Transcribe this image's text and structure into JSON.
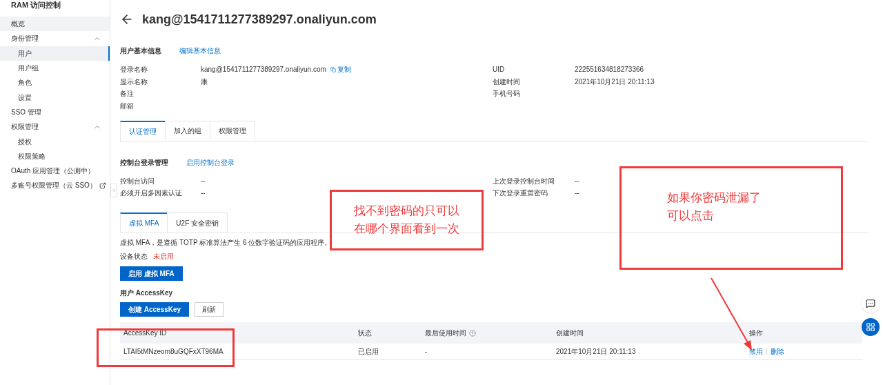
{
  "sidebar": {
    "title": "RAM 访问控制",
    "items": [
      {
        "label": "概览",
        "selected": false,
        "highlighted": true
      },
      {
        "label": "身份管理",
        "expanded": true,
        "children": [
          {
            "label": "用户",
            "selected": true
          },
          {
            "label": "用户组",
            "selected": false
          },
          {
            "label": "角色",
            "selected": false
          },
          {
            "label": "设置",
            "selected": false
          }
        ]
      },
      {
        "label": "SSO 管理",
        "selected": false
      },
      {
        "label": "权限管理",
        "expanded": true,
        "children": [
          {
            "label": "授权",
            "selected": false
          },
          {
            "label": "权限策略",
            "selected": false
          }
        ]
      },
      {
        "label": "OAuth 应用管理（公测中）",
        "selected": false
      },
      {
        "label": "多账号权限管理（云 SSO）",
        "selected": false,
        "external": true
      }
    ]
  },
  "page": {
    "title": "kang@1541711277389297.onaliyun.com"
  },
  "basic_info": {
    "heading": "用户基本信息",
    "action": "编辑基本信息",
    "left_fields": [
      {
        "label": "登录名称",
        "value": "kang@1541711277389297.onaliyun.com",
        "action": "复制"
      },
      {
        "label": "显示名称",
        "value": "康"
      },
      {
        "label": "备注"
      },
      {
        "label": "邮箱"
      }
    ],
    "right_fields": [
      {
        "label": "UID",
        "value": "222551634818273366"
      },
      {
        "label": "创建时间",
        "value": "2021年10月21日 20:11:13"
      },
      {
        "label": "手机号码"
      }
    ]
  },
  "tabs": [
    {
      "label": "认证管理",
      "selected": true
    },
    {
      "label": "加入的组",
      "selected": false
    },
    {
      "label": "权限管理",
      "selected": false
    }
  ],
  "console_login": {
    "heading": "控制台登录管理",
    "action": "启用控制台登录",
    "left_fields": [
      {
        "label": "控制台访问",
        "value": "--"
      },
      {
        "label": "必须开启多因素认证",
        "value": "--"
      }
    ],
    "right_fields": [
      {
        "label": "上次登录控制台时间",
        "value": "--"
      },
      {
        "label": "下次登录重置密码",
        "value": "--"
      }
    ]
  },
  "mfa_tabs": [
    {
      "label": "虚拟 MFA",
      "selected": true
    },
    {
      "label": "U2F 安全密钥",
      "selected": false
    }
  ],
  "mfa": {
    "description": "虚拟 MFA，是遵循 TOTP 标准算法产生 6 位数字验证码的应用程序。",
    "status_label": "设备状态",
    "status": "未启用",
    "button": "启用 虚拟 MFA"
  },
  "access_key": {
    "heading": "用户 AccessKey",
    "create_button": "创建 AccessKey",
    "refresh_button": "刷新",
    "table": {
      "columns": [
        {
          "label": "AccessKey ID"
        },
        {
          "label": "状态"
        },
        {
          "label": "最后使用时间",
          "help": true
        },
        {
          "label": "创建时间"
        },
        {
          "label": "操作"
        }
      ],
      "rows": [
        {
          "id": "LTAI5tMNzeom8uGQFxXT96MA",
          "status": "已启用",
          "last_used": "-",
          "created": "2021年10月21日 20:11:13",
          "actions": [
            "禁用",
            "删除"
          ]
        }
      ]
    }
  },
  "annotations": [
    {
      "kind": "box",
      "lines": [
        "找不到密码的只可以",
        "在哪个界面看到一次"
      ]
    },
    {
      "kind": "box",
      "lines": [
        "如果你密码泄漏了",
        "可以点击"
      ]
    },
    {
      "kind": "box"
    },
    {
      "kind": "arrow"
    }
  ]
}
